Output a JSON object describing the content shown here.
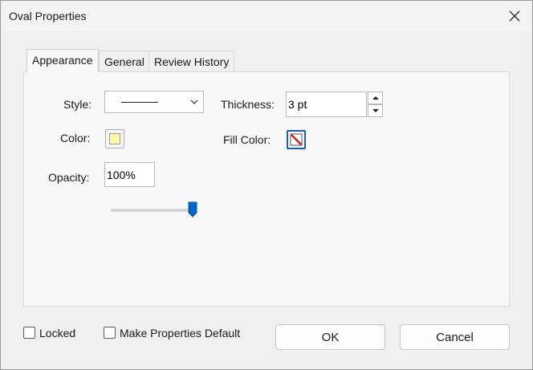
{
  "window": {
    "title": "Oval Properties"
  },
  "tabs": [
    {
      "label": "Appearance",
      "active": true
    },
    {
      "label": "General",
      "active": false
    },
    {
      "label": "Review History",
      "active": false
    }
  ],
  "appearance": {
    "style_label": "Style:",
    "style_value": "solid-line",
    "color_label": "Color:",
    "color_value": "#fff7a8",
    "opacity_label": "Opacity:",
    "opacity_value": "100%",
    "opacity_slider_fraction": 1.0,
    "thickness_label": "Thickness:",
    "thickness_value": "3 pt",
    "fill_color_label": "Fill Color:",
    "fill_color_value": "none"
  },
  "footer": {
    "locked_label": "Locked",
    "locked_checked": false,
    "make_default_label": "Make Properties Default",
    "make_default_checked": false,
    "ok_label": "OK",
    "cancel_label": "Cancel"
  },
  "colors": {
    "accent": "#0067c0",
    "focus": "#1a5fb4"
  }
}
